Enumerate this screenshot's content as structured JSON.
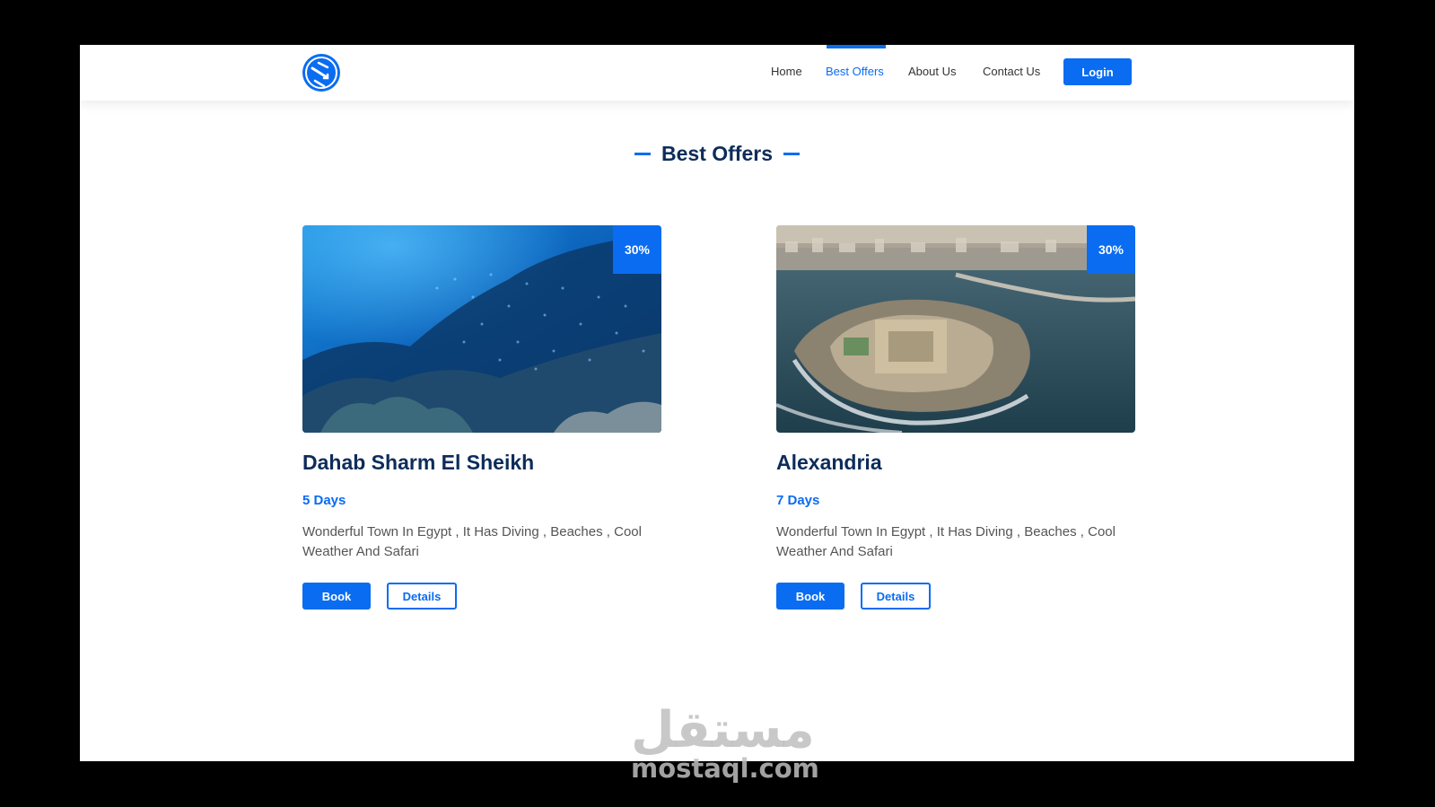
{
  "header": {
    "nav": [
      {
        "label": "Home"
      },
      {
        "label": "Best Offers",
        "active": true
      },
      {
        "label": "About Us"
      },
      {
        "label": "Contact Us"
      }
    ],
    "login_label": "Login",
    "logo_icon": "exchange-arrows-icon"
  },
  "section": {
    "title": "Best Offers"
  },
  "offers": [
    {
      "discount": "30%",
      "title": "Dahab Sharm El Sheikh",
      "days": "5 Days",
      "description": "Wonderful Town In Egypt , It Has Diving , Beaches , Cool Weather And Safari",
      "book_label": "Book",
      "details_label": "Details",
      "image": "underwater-coral-reef-photo"
    },
    {
      "discount": "30%",
      "title": "Alexandria",
      "days": "7 Days",
      "description": "Wonderful Town In Egypt , It Has Diving , Beaches , Cool Weather And Safari",
      "book_label": "Book",
      "details_label": "Details",
      "image": "alexandria-citadel-aerial-photo"
    }
  ],
  "watermark": {
    "arabic": "مستقل",
    "latin": "mostaql.com"
  },
  "colors": {
    "accent": "#0a6cf1",
    "title": "#0d2c5a",
    "text": "#555555"
  }
}
